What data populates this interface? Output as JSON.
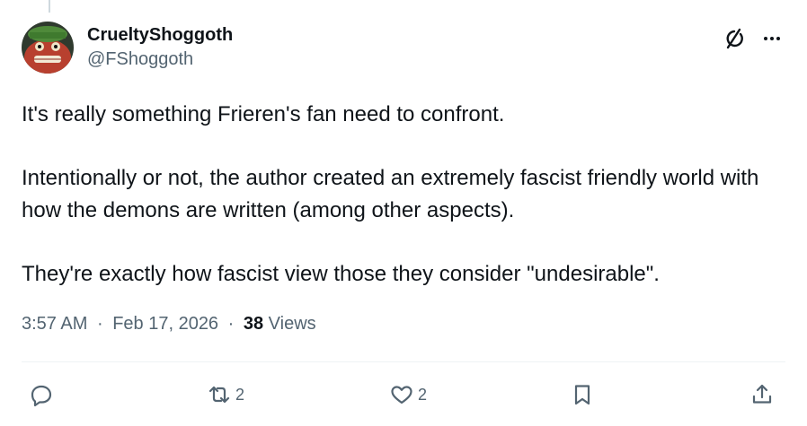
{
  "author": {
    "display_name": "CrueltyShoggoth",
    "handle": "@FShoggoth",
    "avatar": "avatar-image"
  },
  "top_icons": [
    "grok-icon",
    "more-options-icon"
  ],
  "post": {
    "paragraphs": [
      "It's really something Frieren's fan need to confront.",
      "Intentionally or not, the author created an extremely fascist friendly world with how the demons are written (among other aspects).",
      "They're exactly how fascist view those they consider \"undesirable\"."
    ]
  },
  "meta": {
    "time": "3:57 AM",
    "separator": "·",
    "date": "Feb 17, 2026",
    "views_count": "38",
    "views_label": "Views"
  },
  "actions": {
    "reply": {
      "icon": "reply-icon",
      "count": ""
    },
    "repost": {
      "icon": "repost-icon",
      "count": "2"
    },
    "like": {
      "icon": "like-icon",
      "count": "2"
    },
    "bookmark": {
      "icon": "bookmark-icon",
      "count": ""
    },
    "share": {
      "icon": "share-icon",
      "count": ""
    }
  },
  "colors": {
    "text": "#0f1419",
    "secondary": "#536471",
    "divider": "#eff3f4"
  }
}
